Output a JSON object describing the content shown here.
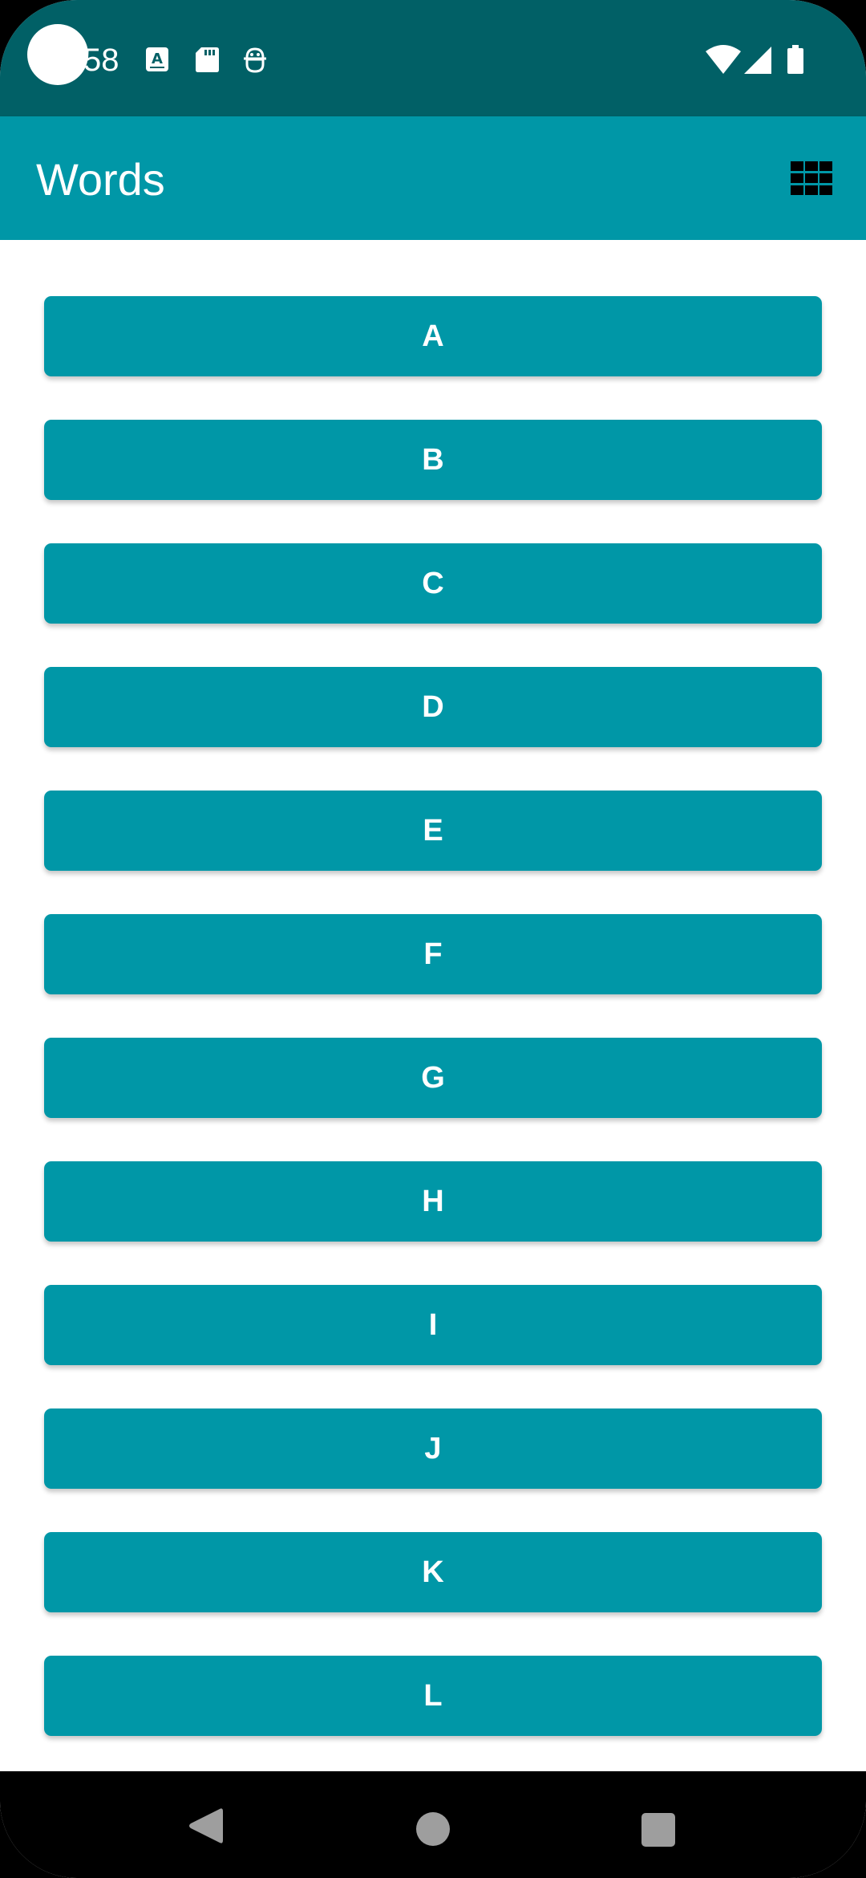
{
  "status_bar": {
    "time": "58",
    "icons": [
      "text-a-icon",
      "sd-card-icon",
      "android-debug-icon",
      "wifi-icon",
      "signal-icon",
      "battery-icon"
    ]
  },
  "app_bar": {
    "title": "Words",
    "action_icon": "grid-layout-icon"
  },
  "letters": [
    "A",
    "B",
    "C",
    "D",
    "E",
    "F",
    "G",
    "H",
    "I",
    "J",
    "K",
    "L"
  ],
  "nav_bar": {
    "icons": [
      "back-icon",
      "home-icon",
      "recents-icon"
    ]
  },
  "colors": {
    "status_bar": "#016066",
    "primary": "#0097A7",
    "on_primary": "#ffffff",
    "nav_bar": "#000000"
  }
}
